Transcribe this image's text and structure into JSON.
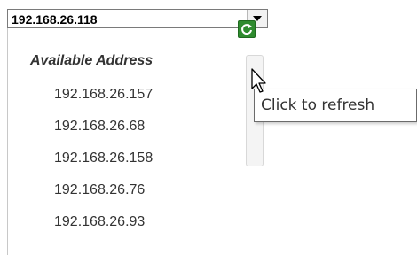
{
  "combo": {
    "selected_value": "192.168.26.118"
  },
  "dropdown": {
    "header": "Available Address",
    "items": [
      "192.168.26.157",
      "192.168.26.68",
      "192.168.26.158",
      "192.168.26.76",
      "192.168.26.93"
    ]
  },
  "tooltip": {
    "text": "Click to refresh"
  },
  "icons": {
    "combo_arrow": "chevron-down-icon",
    "refresh": "refresh-icon",
    "cursor": "mouse-pointer-icon"
  },
  "colors": {
    "refresh_green": "#2e8b2e"
  }
}
